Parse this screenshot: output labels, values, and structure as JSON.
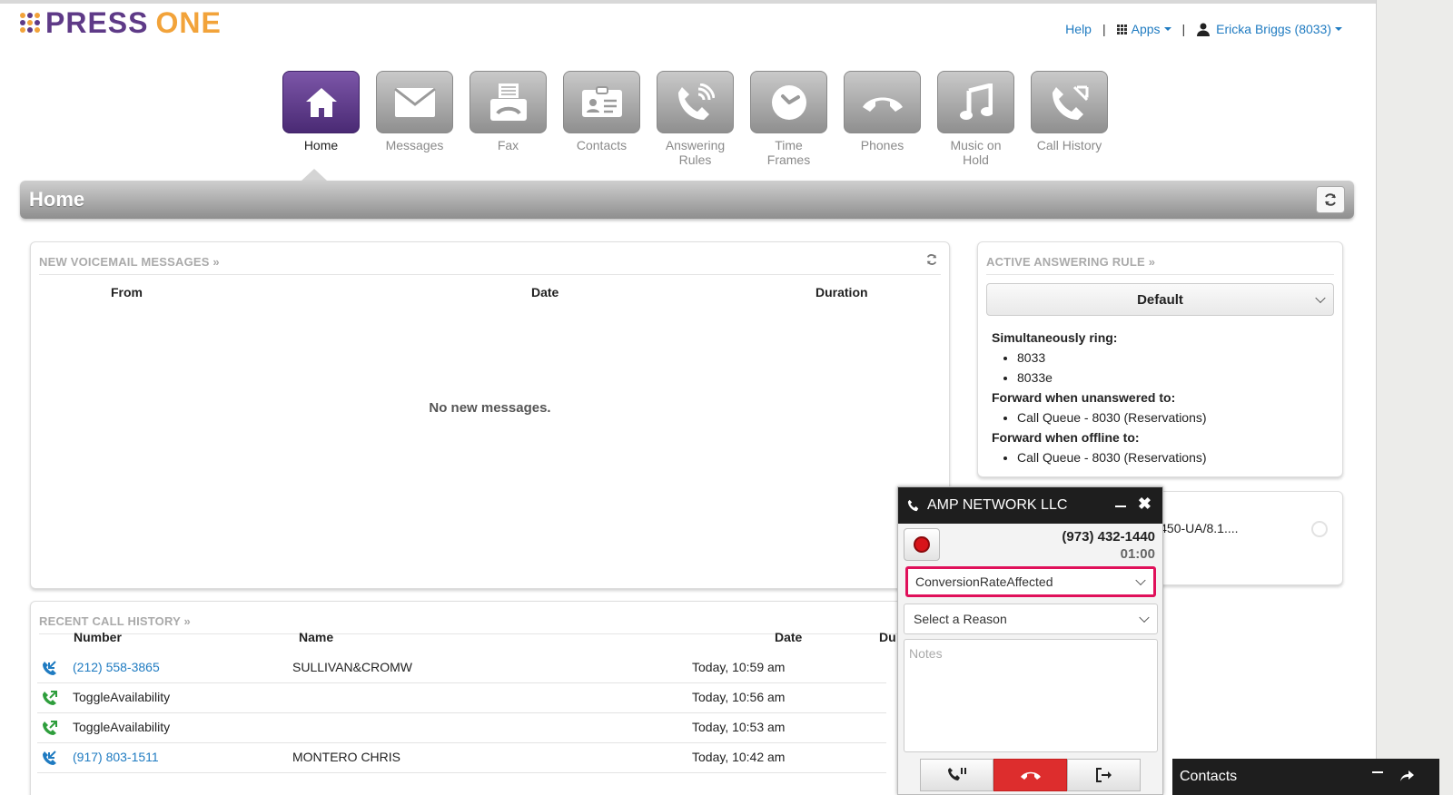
{
  "brand": {
    "name_part1": "PRESS",
    "name_part2": "ONE",
    "dot_colors": [
      "#f2a33a",
      "#5e3a87",
      "#f2a33a",
      "#5e3a87",
      "#f2a33a",
      "#5e3a87",
      "#f2a33a",
      "#5e3a87",
      "#f2a33a"
    ]
  },
  "topnav": {
    "help": "Help",
    "apps": "Apps",
    "user": "Ericka Briggs (8033)"
  },
  "nav": [
    {
      "label": "Home",
      "icon": "home-icon",
      "active": true
    },
    {
      "label": "Messages",
      "icon": "envelope-icon",
      "active": false
    },
    {
      "label": "Fax",
      "icon": "fax-icon",
      "active": false
    },
    {
      "label": "Contacts",
      "icon": "contact-card-icon",
      "active": false
    },
    {
      "label": "Answering\nRules",
      "icon": "phone-ringing-icon",
      "active": false
    },
    {
      "label": "Time\nFrames",
      "icon": "clock-icon",
      "active": false
    },
    {
      "label": "Phones",
      "icon": "handset-icon",
      "active": false
    },
    {
      "label": "Music on\nHold",
      "icon": "music-note-icon",
      "active": false
    },
    {
      "label": "Call History",
      "icon": "call-history-icon",
      "active": false
    }
  ],
  "page": {
    "title": "Home"
  },
  "voicemail": {
    "title": "NEW VOICEMAIL MESSAGES »",
    "col_from": "From",
    "col_date": "Date",
    "col_duration": "Duration",
    "empty": "No new messages."
  },
  "answering_rule": {
    "title": "ACTIVE ANSWERING RULE »",
    "selected": "Default",
    "sim_ring_label": "Simultaneously ring:",
    "sim_ring": [
      "8033",
      "8033e"
    ],
    "unanswered_label": "Forward when unanswered to:",
    "unanswered": [
      "Call Queue - 8030 (Reservations)"
    ],
    "offline_label": "Forward when offline to:",
    "offline": [
      "Call Queue - 8030 (Reservations)"
    ]
  },
  "phones_panel": {
    "device": "_E450-UA/8.1...."
  },
  "call_history": {
    "title": "RECENT CALL HISTORY »",
    "col_number": "Number",
    "col_name": "Name",
    "col_date": "Date",
    "col_duration": "Du",
    "rows": [
      {
        "number": "(212) 558-3865",
        "name": "SULLIVAN&CROMW",
        "date": "Today, 10:59 am",
        "type": "inbound",
        "color": "#1f7bc1",
        "link": true
      },
      {
        "number": "ToggleAvailability",
        "name": "",
        "date": "Today, 10:56 am",
        "type": "outbound",
        "color": "#2e9e3c",
        "link": false
      },
      {
        "number": "ToggleAvailability",
        "name": "",
        "date": "Today, 10:53 am",
        "type": "outbound",
        "color": "#2e9e3c",
        "link": false
      },
      {
        "number": "(917) 803-1511",
        "name": "MONTERO CHRIS",
        "date": "Today, 10:42 am",
        "type": "inbound",
        "color": "#1f7bc1",
        "link": true
      }
    ]
  },
  "call_widget": {
    "caller": "AMP NETWORK LLC",
    "number": "(973) 432-1440",
    "timer": "01:00",
    "disposition": "ConversionRateAffected",
    "reason_placeholder": "Select a Reason",
    "notes_placeholder": "Notes",
    "highlight_color": "#e0105a"
  },
  "contacts_bar": {
    "label": "Contacts"
  }
}
